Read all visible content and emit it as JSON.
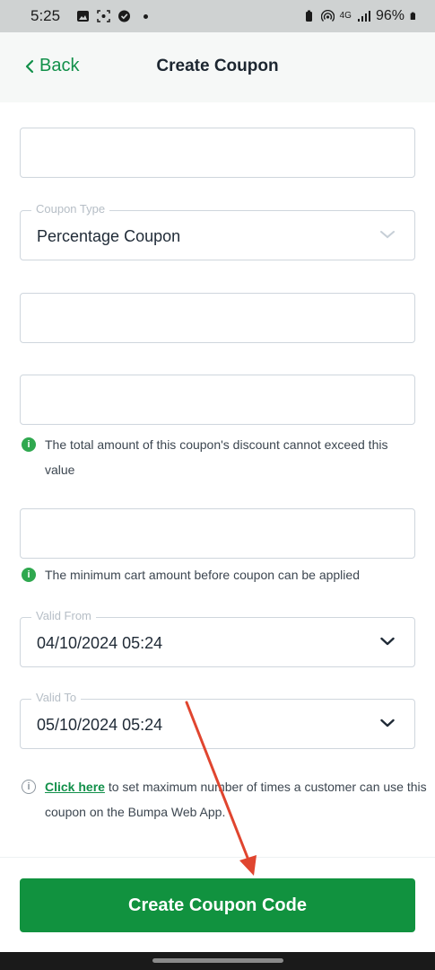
{
  "status_bar": {
    "time": "5:25",
    "battery": "96%",
    "network": "4G"
  },
  "header": {
    "back_label": "Back",
    "title": "Create Coupon"
  },
  "form": {
    "coupon_type": {
      "legend": "Coupon Type",
      "value": "Percentage Coupon"
    },
    "max_discount_hint": "The total amount of this coupon's discount cannot exceed this value",
    "min_cart_hint": "The minimum cart amount before coupon can be applied",
    "valid_from": {
      "legend": "Valid From",
      "value": "04/10/2024 05:24"
    },
    "valid_to": {
      "legend": "Valid To",
      "value": "05/10/2024 05:24"
    },
    "usage_hint": {
      "link": "Click here",
      "text": " to set maximum number of times a customer can use this coupon on the Bumpa Web App."
    }
  },
  "footer": {
    "submit_label": "Create Coupon Code"
  },
  "colors": {
    "brand_green": "#11923f",
    "link_green": "#12904a",
    "annotation_arrow": "#e0452f"
  }
}
